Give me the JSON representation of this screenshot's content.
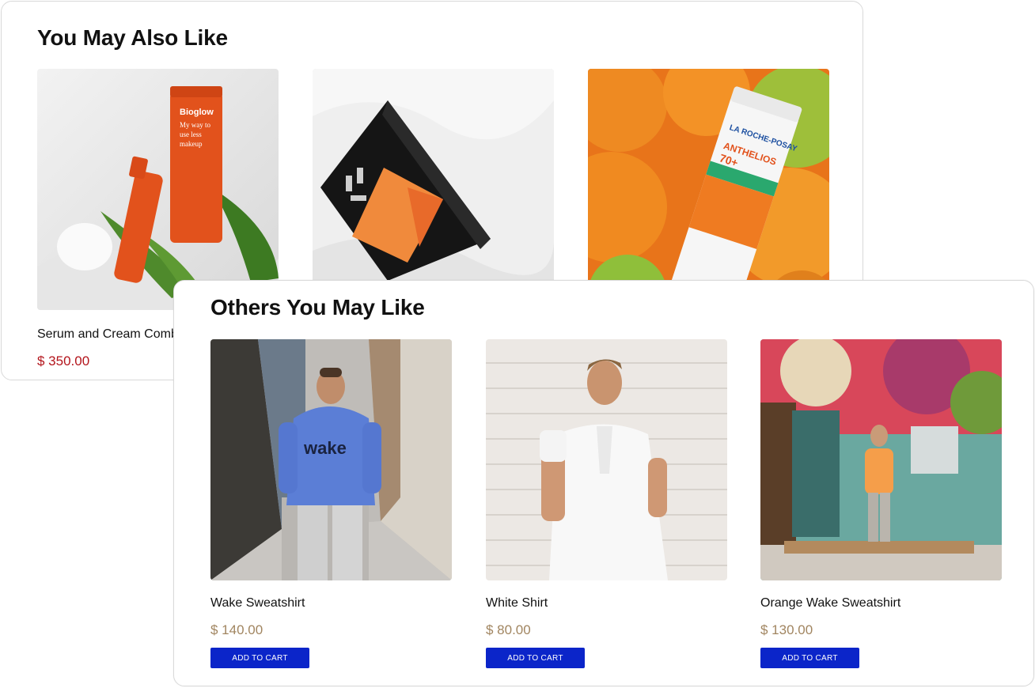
{
  "back_section": {
    "title": "You May Also Like",
    "products": [
      {
        "name": "Serum and Cream Combo",
        "price": "$ 350.00",
        "image": "orange-skincare-bottles-photo"
      },
      {
        "name": "",
        "price": "",
        "image": "black-makeup-palette-photo"
      },
      {
        "name": "",
        "price": "",
        "image": "sunscreen-tube-oranges-photo"
      }
    ]
  },
  "front_section": {
    "title": "Others You May Like",
    "add_to_cart_label": "ADD TO CART",
    "products": [
      {
        "name": "Wake Sweatshirt",
        "price": "$ 140.00",
        "image": "man-blue-hoodie-alley-photo"
      },
      {
        "name": "White Shirt",
        "price": "$ 80.00",
        "image": "man-white-shirt-brick-wall-photo"
      },
      {
        "name": "Orange Wake Sweatshirt",
        "price": "$ 130.00",
        "image": "man-orange-sweatshirt-graffiti-photo"
      }
    ]
  },
  "colors": {
    "back_price": "#b3141b",
    "front_price": "#a18560",
    "button": "#0b25c9"
  }
}
